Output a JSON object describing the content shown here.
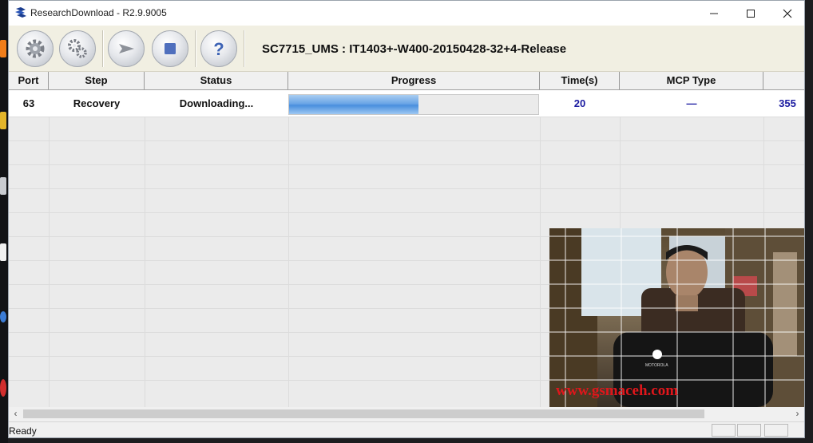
{
  "window": {
    "title": "ResearchDownload - R2.9.9005",
    "icon": "research-download-logo-icon"
  },
  "window_controls": [
    "minimize-icon",
    "maximize-icon",
    "close-icon"
  ],
  "toolbar": {
    "buttons": [
      {
        "name": "settings-button",
        "icon": "gear-icon"
      },
      {
        "name": "load-packet-button",
        "icon": "double-gear-icon"
      },
      {
        "name": "start-button",
        "icon": "play-arrow-icon"
      },
      {
        "name": "stop-button",
        "icon": "stop-square-icon"
      },
      {
        "name": "help-button",
        "icon": "question-mark-icon"
      }
    ],
    "project_label": "SC7715_UMS : IT1403+-W400-20150428-32+4-Release"
  },
  "grid": {
    "columns": [
      "Port",
      "Step",
      "Status",
      "Progress",
      "Time(s)",
      "MCP Type",
      ""
    ],
    "rows": [
      {
        "port": "63",
        "step": "Recovery",
        "status": "Downloading...",
        "progress": 0.52,
        "time": "20",
        "mcp_type": "—",
        "extra": "355"
      }
    ]
  },
  "statusbar": {
    "text": "Ready"
  },
  "overlay": {
    "watermark": "www.gsmaceh.com",
    "shirt_logo": "MOTOROLA"
  },
  "colors": {
    "progress_fill": "#4a8fde",
    "time_text": "#1a1aa0",
    "watermark": "#e0161b"
  }
}
